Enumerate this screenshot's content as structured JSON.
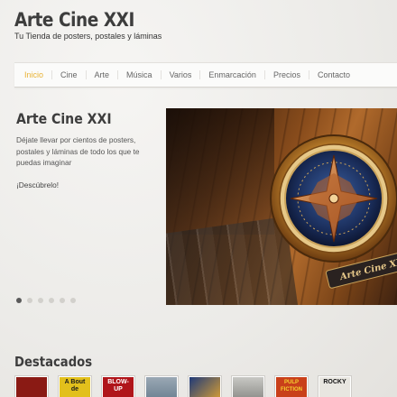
{
  "site": {
    "title": "Arte Cine XXI",
    "tagline": "Tu Tienda de posters, postales y láminas"
  },
  "nav": {
    "items": [
      {
        "label": "Inicio",
        "active": true
      },
      {
        "label": "Cine"
      },
      {
        "label": "Arte"
      },
      {
        "label": "Música"
      },
      {
        "label": "Varios"
      },
      {
        "label": "Enmarcación"
      },
      {
        "label": "Precios"
      },
      {
        "label": "Contacto"
      }
    ]
  },
  "hero": {
    "title": "Arte Cine XXI",
    "text": "Déjate llevar por cientos de posters, postales y láminas de todo los que te puedas imaginar",
    "cta": "¡Descúbrelo!",
    "image_banner": "Arte Cine XXI",
    "slides_count": 6,
    "active_slide": 0
  },
  "featured": {
    "heading": "Destacados",
    "items": [
      {
        "caption": "",
        "bg": "#8a1a14"
      },
      {
        "caption": "A Bout de",
        "bg": "#e2c01c"
      },
      {
        "caption": "BLOW-UP",
        "bg": "#b0151a"
      },
      {
        "caption": "",
        "bg": "#6b7f90"
      },
      {
        "caption": "",
        "bg": "#1f3a78"
      },
      {
        "caption": "",
        "bg": "#8a8a86"
      },
      {
        "caption": "PULP FICTION",
        "bg": "#c9401a"
      },
      {
        "caption": "ROCKY",
        "bg": "#e8e6e0"
      }
    ]
  },
  "colors": {
    "accent": "#e8b234",
    "text": "#3d3d3d",
    "background": "#efedea"
  }
}
